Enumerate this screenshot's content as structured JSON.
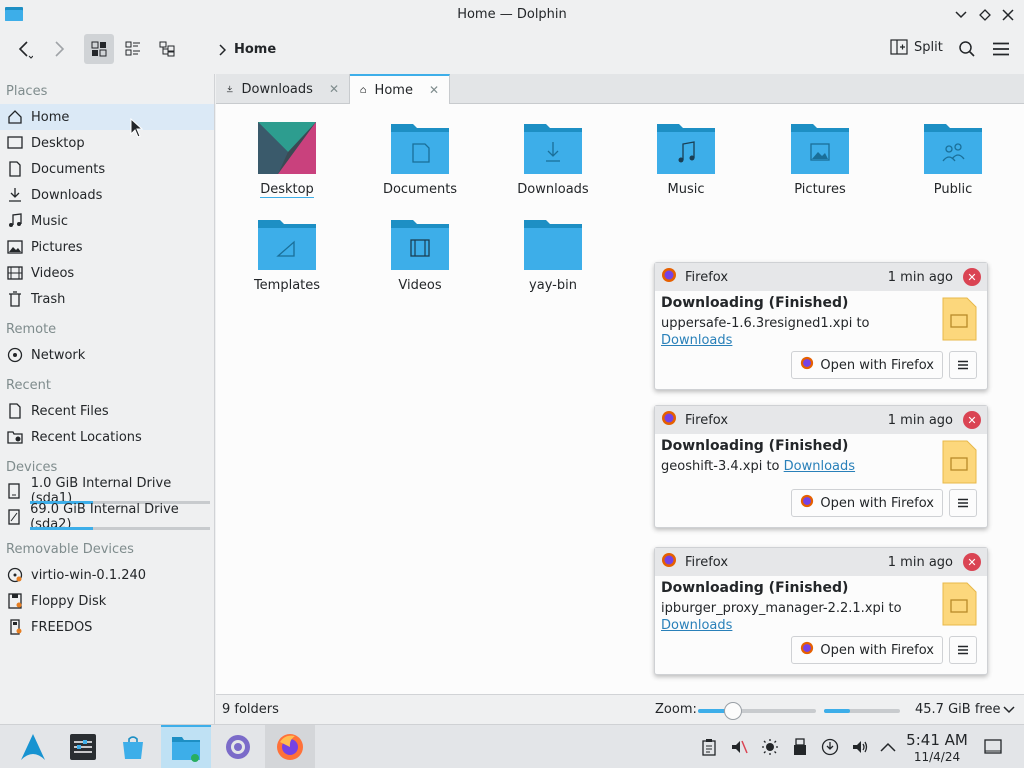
{
  "window": {
    "title": "Home — Dolphin"
  },
  "toolbar": {
    "breadcrumb": "Home",
    "split_label": "Split"
  },
  "sidebar": {
    "sections": {
      "places": "Places",
      "remote": "Remote",
      "recent": "Recent",
      "devices": "Devices",
      "removable": "Removable Devices"
    },
    "places": [
      "Home",
      "Desktop",
      "Documents",
      "Downloads",
      "Music",
      "Pictures",
      "Videos",
      "Trash"
    ],
    "remote": [
      "Network"
    ],
    "recent": [
      "Recent Files",
      "Recent Locations"
    ],
    "devices": [
      {
        "label": "1.0 GiB Internal Drive (sda1)",
        "usage": 0.35
      },
      {
        "label": "69.0 GiB Internal Drive (sda2)",
        "usage": 0.35
      }
    ],
    "removable": [
      "virtio-win-0.1.240",
      "Floppy Disk",
      "FREEDOS"
    ]
  },
  "tabs": [
    {
      "label": "Downloads",
      "active": false
    },
    {
      "label": "Home",
      "active": true
    }
  ],
  "folders": [
    "Desktop",
    "Documents",
    "Downloads",
    "Music",
    "Pictures",
    "Public",
    "Templates",
    "Videos",
    "yay-bin"
  ],
  "statusbar": {
    "count": "9 folders",
    "zoom_label": "Zoom:",
    "zoom_level": 0.3,
    "free_space": "45.7 GiB free",
    "free_fraction": 0.34
  },
  "notifications": [
    {
      "app": "Firefox",
      "time": "1 min ago",
      "title": "Downloading (Finished)",
      "file_text": "uppersafe-1.6.3resigned1.xpi to",
      "link": "Downloads",
      "action": "Open with Firefox"
    },
    {
      "app": "Firefox",
      "time": "1 min ago",
      "title": "Downloading (Finished)",
      "file_text": "geoshift-3.4.xpi to",
      "link": "Downloads",
      "action": "Open with Firefox"
    },
    {
      "app": "Firefox",
      "time": "1 min ago",
      "title": "Downloading (Finished)",
      "file_text": "ipburger_proxy_manager-2.2.1.xpi to",
      "link": "Downloads",
      "action": "Open with Firefox"
    }
  ],
  "clock": {
    "time": "5:41 AM",
    "date": "11/4/24"
  },
  "colors": {
    "accent": "#3daee9",
    "folder": "#3daee9",
    "folder_dark": "#1d8fc4",
    "close_red": "#da4453"
  }
}
